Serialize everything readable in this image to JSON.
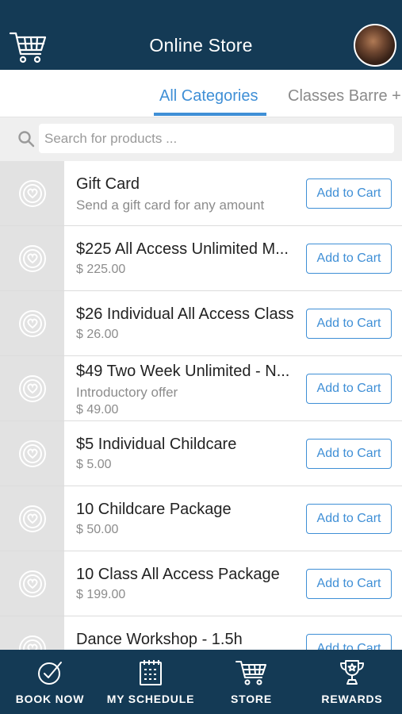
{
  "header": {
    "title": "Online Store",
    "cart_icon": "cart-icon",
    "avatar": "profile-avatar"
  },
  "tabs": [
    {
      "label": "All Categories",
      "active": true
    },
    {
      "label": "Classes Barre +",
      "active": false
    }
  ],
  "search": {
    "placeholder": "Search for products ...",
    "value": ""
  },
  "products": [
    {
      "name": "Gift Card",
      "subtitle": "Send a gift card for any amount",
      "price": "",
      "button": "Add to Cart"
    },
    {
      "name": "$225 All Access Unlimited M...",
      "subtitle": "",
      "price": "$ 225.00",
      "button": "Add to Cart"
    },
    {
      "name": "$26 Individual All Access Class",
      "subtitle": "",
      "price": "$ 26.00",
      "button": "Add to Cart"
    },
    {
      "name": "$49 Two Week Unlimited - N...",
      "subtitle": "Introductory offer",
      "price": "$ 49.00",
      "button": "Add to Cart"
    },
    {
      "name": "$5 Individual Childcare",
      "subtitle": "",
      "price": "$ 5.00",
      "button": "Add to Cart"
    },
    {
      "name": "10 Childcare Package",
      "subtitle": "",
      "price": "$ 50.00",
      "button": "Add to Cart"
    },
    {
      "name": "10 Class All Access Package",
      "subtitle": "",
      "price": "$ 199.00",
      "button": "Add to Cart"
    },
    {
      "name": "Dance Workshop - 1.5h",
      "subtitle": "",
      "price": "",
      "button": "Add to Cart"
    }
  ],
  "bottom_nav": [
    {
      "label": "BOOK NOW",
      "icon": "check-circle-icon"
    },
    {
      "label": "MY SCHEDULE",
      "icon": "calendar-icon"
    },
    {
      "label": "STORE",
      "icon": "cart-icon"
    },
    {
      "label": "REWARDS",
      "icon": "trophy-icon"
    }
  ],
  "colors": {
    "header_bg": "#143a55",
    "accent": "#3f8fd6",
    "thumb_bg": "#e2e2e2"
  }
}
